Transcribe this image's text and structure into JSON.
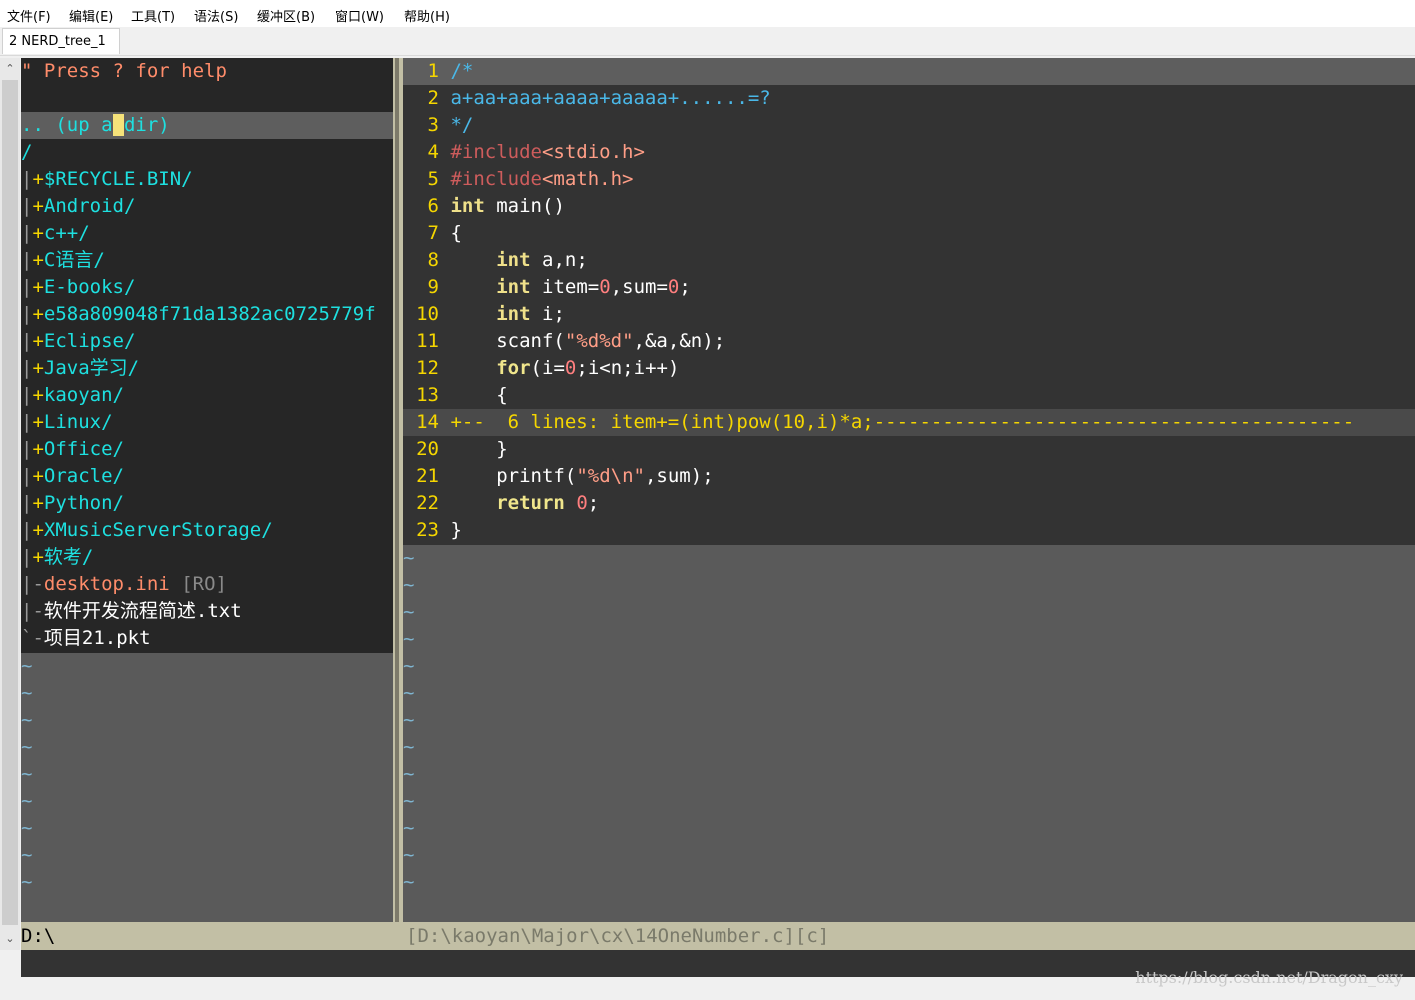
{
  "menubar": {
    "items": [
      "文件(F)",
      "编辑(E)",
      "工具(T)",
      "语法(S)",
      "缓冲区(B)",
      "窗口(W)",
      "帮助(H)"
    ]
  },
  "tabs": [
    "2 NERD_tree_1"
  ],
  "nerdtree": {
    "help_line": "\" Press ? for help",
    "up_line_before_cursor": ".. (up a",
    "up_line_cursor": " ",
    "up_line_after_cursor": "dir)",
    "root": "/",
    "entries": [
      {
        "prefix": "|",
        "marker": "+",
        "name": "$RECYCLE.BIN/"
      },
      {
        "prefix": "|",
        "marker": "+",
        "name": "Android/"
      },
      {
        "prefix": "|",
        "marker": "+",
        "name": "c++/"
      },
      {
        "prefix": "|",
        "marker": "+",
        "name": "C语言/"
      },
      {
        "prefix": "|",
        "marker": "+",
        "name": "E-books/"
      },
      {
        "prefix": "|",
        "marker": "+",
        "name": "e58a809048f71da1382ac0725779f"
      },
      {
        "prefix": "|",
        "marker": "+",
        "name": "Eclipse/"
      },
      {
        "prefix": "|",
        "marker": "+",
        "name": "Java学习/"
      },
      {
        "prefix": "|",
        "marker": "+",
        "name": "kaoyan/"
      },
      {
        "prefix": "|",
        "marker": "+",
        "name": "Linux/"
      },
      {
        "prefix": "|",
        "marker": "+",
        "name": "Office/"
      },
      {
        "prefix": "|",
        "marker": "+",
        "name": "Oracle/"
      },
      {
        "prefix": "|",
        "marker": "+",
        "name": "Python/"
      },
      {
        "prefix": "|",
        "marker": "+",
        "name": "XMusicServerStorage/"
      },
      {
        "prefix": "|",
        "marker": "+",
        "name": "软考/"
      }
    ],
    "files": [
      {
        "prefix": "|",
        "marker": "-",
        "name": "desktop.ini",
        "flag": "[RO]"
      },
      {
        "prefix": "|",
        "marker": "-",
        "name": "软件开发流程简述.txt",
        "flag": ""
      },
      {
        "prefix": "`",
        "marker": "-",
        "name": "项目21.pkt",
        "flag": ""
      }
    ],
    "tilde": "~",
    "status": "D:\\"
  },
  "code": {
    "lines": [
      {
        "n": "1",
        "text": "/*"
      },
      {
        "n": "2",
        "text": "a+aa+aaa+aaaa+aaaaa+......=?"
      },
      {
        "n": "3",
        "text": "*/"
      },
      {
        "n": "4",
        "text": "#include<stdio.h>"
      },
      {
        "n": "5",
        "text": "#include<math.h>"
      },
      {
        "n": "6",
        "text": "int main()"
      },
      {
        "n": "7",
        "text": "{"
      },
      {
        "n": "8",
        "text": "    int a,n;"
      },
      {
        "n": "9",
        "text": "    int item=0,sum=0;"
      },
      {
        "n": "10",
        "text": "    int i;"
      },
      {
        "n": "11",
        "text": "    scanf(\"%d%d\",&a,&n);"
      },
      {
        "n": "12",
        "text": "    for(i=0;i<n;i++)"
      },
      {
        "n": "13",
        "text": "    {"
      },
      {
        "n": "14",
        "text": "+--  6 lines: item+=(int)pow(10,i)*a;------------------------------------------"
      },
      {
        "n": "20",
        "text": "    }"
      },
      {
        "n": "21",
        "text": "    printf(\"%d\\n\",sum);"
      },
      {
        "n": "22",
        "text": "    return 0;"
      },
      {
        "n": "23",
        "text": "}"
      }
    ],
    "tilde": "~",
    "status": "[D:\\kaoyan\\Major\\cx\\14OneNumber.c][c]"
  },
  "watermark": "https://blog.csdn.net/Dragon_cxy",
  "colors": {
    "background": "#333333",
    "line_number": "#f5d600",
    "directory": "#1ee0e0",
    "comment": "#4ab8e8",
    "preproc": "#cd5c5c",
    "type": "#efe08a",
    "string": "#ff9e87",
    "number": "#ff7f7f",
    "statusline": "#c2bfa5"
  }
}
